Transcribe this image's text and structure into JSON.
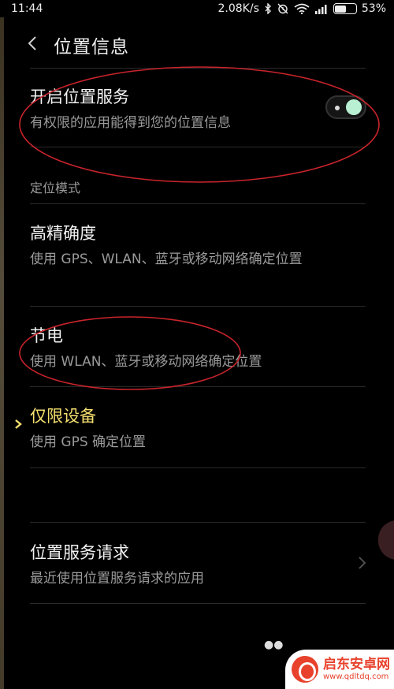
{
  "status_bar": {
    "time": "11:44",
    "speed": "2.08K/s",
    "battery_percent": "53%",
    "battery_level": 0.53,
    "icons": [
      "bluetooth-icon",
      "alarm-off-icon",
      "wifi-icon",
      "signal-icon",
      "battery-icon"
    ]
  },
  "header": {
    "title": "位置信息",
    "back_icon": "chevron-left-icon"
  },
  "location_service": {
    "title": "开启位置服务",
    "subtitle": "有权限的应用能得到您的位置信息",
    "enabled": true
  },
  "mode_section": {
    "label": "定位模式",
    "options": [
      {
        "title": "高精确度",
        "subtitle": "使用 GPS、WLAN、蓝牙或移动网络确定位置",
        "selected": false
      },
      {
        "title": "节电",
        "subtitle": "使用 WLAN、蓝牙或移动网络确定位置",
        "selected": false
      },
      {
        "title": "仅限设备",
        "subtitle": "使用 GPS 确定位置",
        "selected": true
      }
    ]
  },
  "requests": {
    "title": "位置服务请求",
    "subtitle": "最近使用位置服务请求的应用"
  },
  "watermark": {
    "name": "启东安卓网",
    "url": "www.qdltdq.com"
  },
  "colors": {
    "background": "#000000",
    "selected_text": "#f5e06e",
    "toggle_knob": "#b9f0d4",
    "annotation_red": "#c8242b"
  }
}
